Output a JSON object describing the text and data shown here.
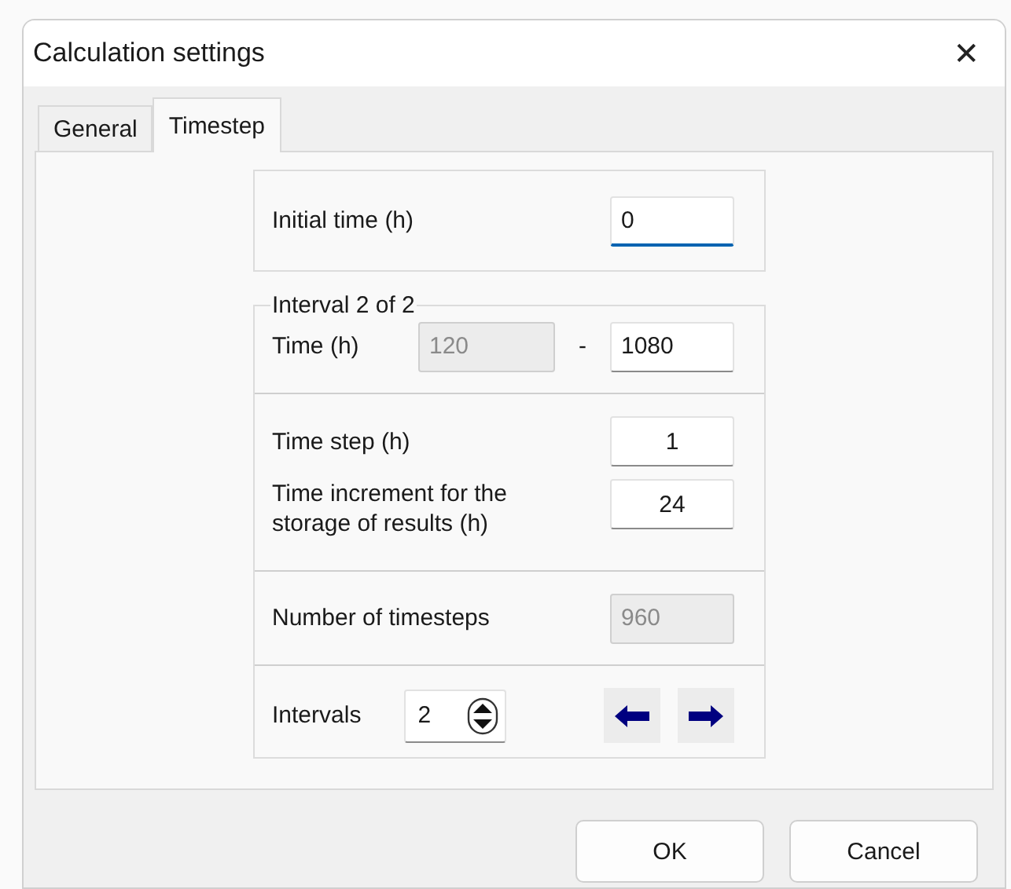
{
  "window": {
    "title": "Calculation settings",
    "close": "✕"
  },
  "tabs": [
    {
      "label": "General",
      "selected": false
    },
    {
      "label": "Timestep",
      "selected": true
    }
  ],
  "initial_time": {
    "label": "Initial time (h)",
    "value": "0",
    "focused": true
  },
  "interval": {
    "title": "Interval 2 of 2",
    "time": {
      "label": "Time (h)",
      "separator": "-",
      "from": {
        "value": "120",
        "disabled": true
      },
      "to": {
        "value": "1080",
        "disabled": false
      }
    },
    "time_step": {
      "label": "Time step (h)",
      "value": "1",
      "disabled": false
    },
    "increment": {
      "label": "Time increment for the storage of results (h)",
      "value": "24",
      "disabled": false
    },
    "timesteps": {
      "label": "Number of timesteps",
      "value": "960",
      "disabled": true
    },
    "intervals": {
      "label": "Intervals",
      "value": "2"
    }
  },
  "buttons": [
    "OK",
    "Cancel"
  ]
}
